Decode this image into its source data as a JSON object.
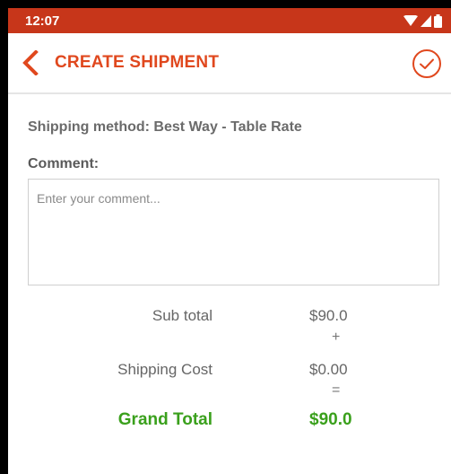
{
  "status_bar": {
    "time": "12:07",
    "icons": [
      "wifi-icon",
      "signal-icon",
      "battery-icon"
    ]
  },
  "toolbar": {
    "title": "CREATE SHIPMENT",
    "back_icon": "chevron-left-icon",
    "confirm_icon": "check-circle-icon"
  },
  "shipping": {
    "method_text": "Shipping method: Best Way - Table Rate"
  },
  "comment": {
    "label": "Comment:",
    "placeholder": "Enter your comment..."
  },
  "totals": {
    "subtotal_label": "Sub total",
    "subtotal_value": "$90.0",
    "plus": "+",
    "shipping_label": "Shipping Cost",
    "shipping_value": "$0.00",
    "equals": "=",
    "grand_label": "Grand Total",
    "grand_value": "$90.0"
  },
  "colors": {
    "status_bar": "#c7361a",
    "accent": "#e0481e",
    "grand_total": "#3aa01c"
  }
}
